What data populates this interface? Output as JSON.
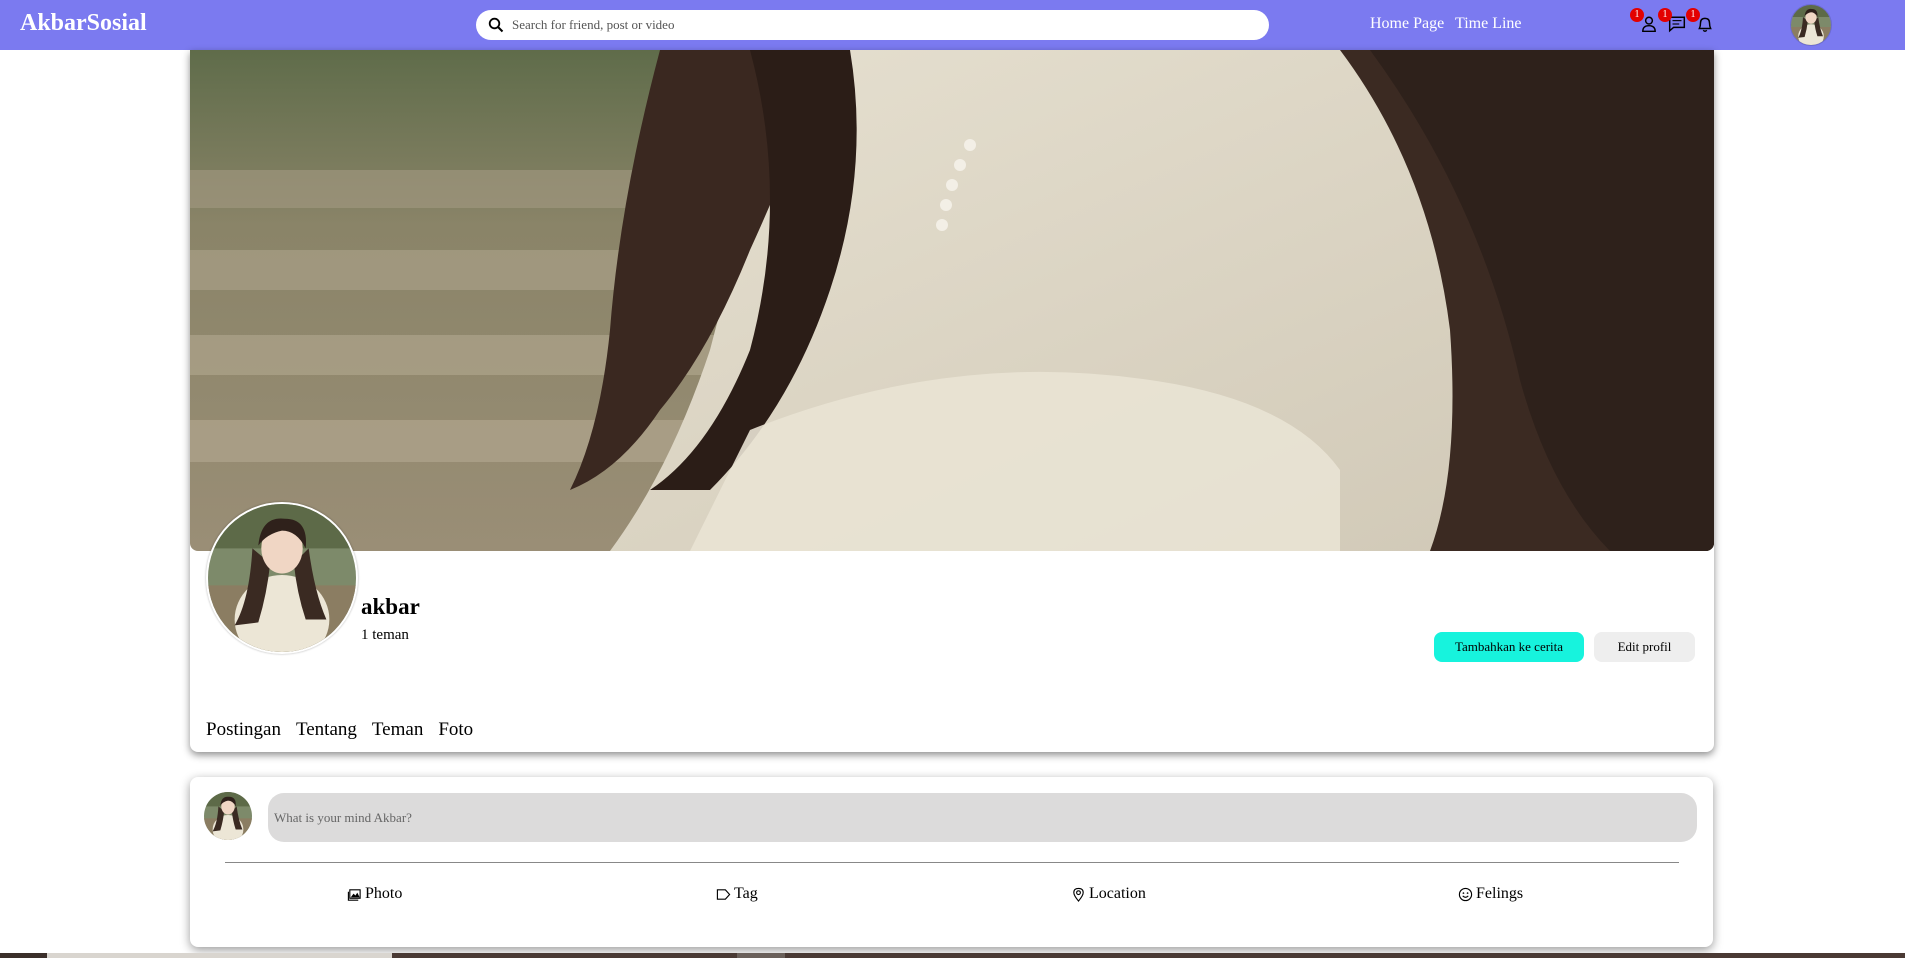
{
  "header": {
    "logo": "AkbarSosial",
    "search_placeholder": "Search for friend, post or video",
    "nav_links": {
      "home": "Home Page",
      "timeline": "Time Line"
    },
    "badges": {
      "friends": "1",
      "messages": "1",
      "notifications": "1"
    }
  },
  "profile": {
    "name": "akbar",
    "friend_count": "1 teman",
    "story_button": "Tambahkan ke cerita",
    "edit_button": "Edit profil",
    "tabs": [
      "Postingan",
      "Tentang",
      "Teman",
      "Foto"
    ]
  },
  "composer": {
    "placeholder": "What is your mind Akbar?",
    "actions": {
      "photo": "Photo",
      "tag": "Tag",
      "location": "Location",
      "feelings": "Felings"
    }
  },
  "colors": {
    "header_bg": "#7b7af0",
    "story_button_bg": "#17f3dd",
    "badge": "#e30000"
  }
}
